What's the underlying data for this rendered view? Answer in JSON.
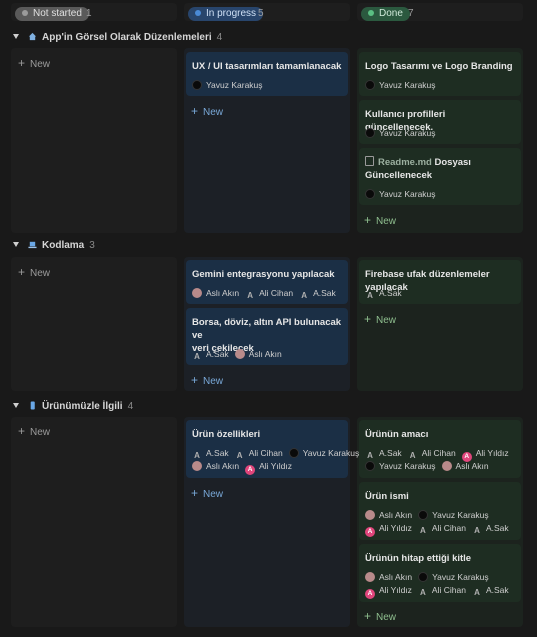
{
  "columns": [
    {
      "label": "Not started",
      "count": "1",
      "color": "#5a5a5a"
    },
    {
      "label": "In progress",
      "count": "5",
      "color": "#28456c"
    },
    {
      "label": "Done",
      "count": "7",
      "color": "#2b593f"
    }
  ],
  "icons": {
    "group1": "house-icon",
    "group2": "laptop-icon",
    "group3": "phone-icon",
    "doc": "document-icon"
  },
  "new_label": "New",
  "groups": [
    {
      "title": "App'in Görsel Olarak Düzenlemeleri",
      "count": "4"
    },
    {
      "title": "Kodlama",
      "count": "3"
    },
    {
      "title": "Ürünümüzle İlgili",
      "count": "4"
    }
  ],
  "cards": {
    "g1_ip1": {
      "title": "UX / UI tasarımları tamamlanacak",
      "people": [
        "Yavuz Karakuş"
      ]
    },
    "g1_d1": {
      "title": "Logo Tasarımı ve Logo Branding",
      "people": [
        "Yavuz Karakuş"
      ]
    },
    "g1_d2": {
      "title": "Kullanıcı profilleri güncellenecek.",
      "people": [
        "Yavuz Karakuş"
      ]
    },
    "g1_d3": {
      "title_a": "Readme.md",
      "title_b": "Dosyası",
      "title_c": "Güncellenecek",
      "people": [
        "Yavuz Karakuş"
      ]
    },
    "g2_ip1": {
      "title": "Gemini entegrasyonu yapılacak",
      "people": [
        "Aslı Akın",
        "Ali Cihan",
        "A.Sak"
      ]
    },
    "g2_ip2": {
      "title_a": "Borsa, döviz, altın API bulunacak ve",
      "title_b": "veri çekilecek",
      "people": [
        "A.Sak",
        "Aslı Akın"
      ]
    },
    "g2_d1": {
      "title": "Firebase ufak düzenlemeler yapılacak",
      "people": [
        "A.Sak"
      ]
    },
    "g3_ip1": {
      "title": "Ürün özellikleri",
      "people": [
        "A.Sak",
        "Ali Cihan",
        "Yavuz Karakuş",
        "Aslı Akın",
        "Ali Yıldız"
      ]
    },
    "g3_d1": {
      "title": "Ürünün amacı",
      "people": [
        "A.Sak",
        "Ali Cihan",
        "Ali Yıldız",
        "Yavuz Karakuş",
        "Aslı Akın"
      ]
    },
    "g3_d2": {
      "title": "Ürün ismi",
      "people": [
        "Aslı Akın",
        "Yavuz Karakuş",
        "Ali Yıldız",
        "Ali Cihan",
        "A.Sak"
      ]
    },
    "g3_d3": {
      "title": "Ürünün hitap ettiği kitle",
      "people": [
        "Aslı Akın",
        "Yavuz Karakuş",
        "Ali Yıldız",
        "Ali Cihan",
        "A.Sak"
      ]
    }
  }
}
